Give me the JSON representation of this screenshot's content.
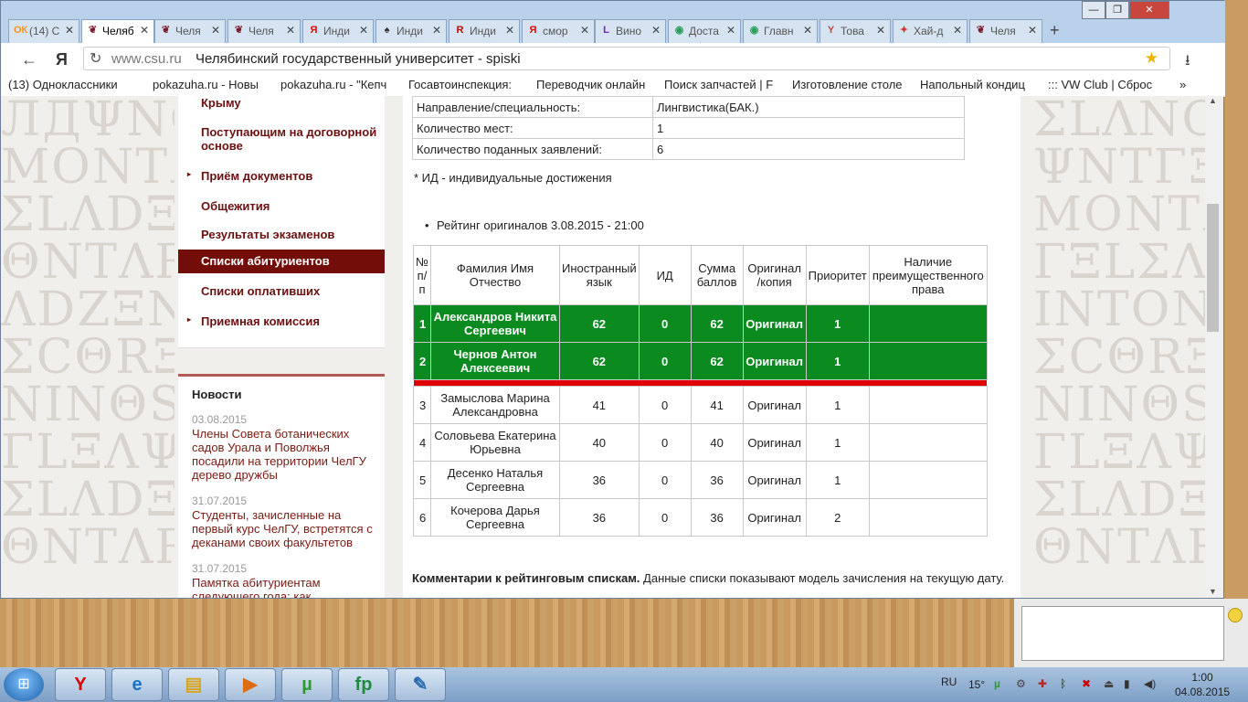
{
  "tabs": [
    {
      "label": "(14) C",
      "icon": "ok-icon",
      "active": false
    },
    {
      "label": "Челяб",
      "icon": "csu-icon",
      "active": true
    },
    {
      "label": "Челя",
      "icon": "csu-icon",
      "active": false
    },
    {
      "label": "Челя",
      "icon": "csu-icon",
      "active": false
    },
    {
      "label": "Инди",
      "icon": "yandex-icon",
      "active": false
    },
    {
      "label": "Инди",
      "icon": "spade-icon",
      "active": false
    },
    {
      "label": "Инди",
      "icon": "r-icon",
      "active": false
    },
    {
      "label": "смор",
      "icon": "yandex-icon",
      "active": false
    },
    {
      "label": "Вино",
      "icon": "l-icon",
      "active": false
    },
    {
      "label": "Доста",
      "icon": "globe-icon",
      "active": false
    },
    {
      "label": "Главн",
      "icon": "globe-icon",
      "active": false
    },
    {
      "label": "Това",
      "icon": "glass-icon",
      "active": false
    },
    {
      "label": "Хай-д",
      "icon": "star-icon",
      "active": false
    },
    {
      "label": "Челя",
      "icon": "csu-icon",
      "active": false
    }
  ],
  "window": {
    "minimize": "—",
    "maximize": "❐",
    "close": "✕"
  },
  "toolbar": {
    "back": "←",
    "brand": "Я",
    "reload": "↻",
    "url": "www.csu.ru",
    "title": "Челябинский государственный университет - spiski",
    "star": "★",
    "download": "⭳"
  },
  "bookmarks": [
    "(13) Одноклассники",
    "pokazuha.ru - Новы",
    "pokazuha.ru - \"Кепч",
    "Госавтоинспекция:",
    "Переводчик онлайн",
    "Поиск запчастей | F",
    "Изготовление столе",
    "Напольный кондиц",
    "::: VW Club | Сброс",
    "»"
  ],
  "sidebar": {
    "items": [
      {
        "label": "Крыму",
        "arrow": false
      },
      {
        "label": "Поступающим на договорной основе",
        "arrow": false
      },
      {
        "label": "Приём документов",
        "arrow": true
      },
      {
        "label": "Общежития",
        "arrow": false
      },
      {
        "label": "Результаты экзаменов",
        "arrow": false
      },
      {
        "label": "Списки абитуриентов",
        "arrow": false,
        "active": true
      },
      {
        "label": "Списки оплативших",
        "arrow": false
      },
      {
        "label": "Приемная комиссия",
        "arrow": true
      }
    ]
  },
  "news": {
    "title": "Новости",
    "items": [
      {
        "date": "03.08.2015",
        "text": "Члены Совета ботанических садов Урала и Поволжья посадили на территории ЧелГУ дерево дружбы"
      },
      {
        "date": "31.07.2015",
        "text": "Студенты, зачисленные на первый курс ЧелГУ, встретятся с деканами своих факультетов"
      },
      {
        "date": "31.07.2015",
        "text": "Памятка абитуриентам следующего года: как"
      }
    ]
  },
  "info": {
    "rows": [
      [
        "Направление/специальность:",
        "Лингвистика(БАК.)"
      ],
      [
        "Количество мест:",
        "1"
      ],
      [
        "Количество поданных заявлений:",
        "6"
      ]
    ],
    "note": "* ИД - индивидуальные достижения",
    "rating_title": "Рейтинг оригиналов 3.08.2015 - 21:00"
  },
  "ranking": {
    "headers": [
      "№ п/п",
      "Фамилия Имя Отчество",
      "Иностранный язык",
      "ИД",
      "Сумма баллов",
      "Оригинал /копия",
      "Приоритет",
      "Наличие преимущественного права"
    ],
    "rows": [
      {
        "n": "1",
        "name": "Александров Никита Сергеевич",
        "lang": "62",
        "id": "0",
        "sum": "62",
        "orig": "Оригинал",
        "prio": "1",
        "pref": "",
        "admitted": true
      },
      {
        "n": "2",
        "name": "Чернов Антон Алексеевич",
        "lang": "62",
        "id": "0",
        "sum": "62",
        "orig": "Оригинал",
        "prio": "1",
        "pref": "",
        "admitted": true
      },
      {
        "n": "3",
        "name": "Замыслова Марина Александровна",
        "lang": "41",
        "id": "0",
        "sum": "41",
        "orig": "Оригинал",
        "prio": "1",
        "pref": "",
        "admitted": false
      },
      {
        "n": "4",
        "name": "Соловьева Екатерина Юрьевна",
        "lang": "40",
        "id": "0",
        "sum": "40",
        "orig": "Оригинал",
        "prio": "1",
        "pref": "",
        "admitted": false
      },
      {
        "n": "5",
        "name": "Десенко Наталья Сергеевна",
        "lang": "36",
        "id": "0",
        "sum": "36",
        "orig": "Оригинал",
        "prio": "1",
        "pref": "",
        "admitted": false
      },
      {
        "n": "6",
        "name": "Кочерова Дарья Сергеевна",
        "lang": "36",
        "id": "0",
        "sum": "36",
        "orig": "Оригинал",
        "prio": "2",
        "pref": "",
        "admitted": false
      }
    ]
  },
  "comment": {
    "bold": "Комментарии к рейтинговым спискам.",
    "text": " Данные списки показывают модель зачисления на текущую дату."
  },
  "colors": {
    "accent": "#720d0a",
    "admitted": "#0a8a1f",
    "cutoff": "#e00000"
  },
  "taskbar": {
    "apps": [
      {
        "name": "yandex-browser-icon",
        "glyph": "Y",
        "color": "#e00000"
      },
      {
        "name": "ie-icon",
        "glyph": "e",
        "color": "#1a73c9"
      },
      {
        "name": "explorer-folder-icon",
        "glyph": "▤",
        "color": "#d9a520"
      },
      {
        "name": "media-player-icon",
        "glyph": "▶",
        "color": "#e06a10"
      },
      {
        "name": "utorrent-icon",
        "glyph": "µ",
        "color": "#2e9b2e"
      },
      {
        "name": "fastreport-icon",
        "glyph": "fp",
        "color": "#1f8a40"
      },
      {
        "name": "notepad-icon",
        "glyph": "✎",
        "color": "#2b6cb0"
      }
    ],
    "lang": "RU",
    "temp": "15°",
    "time": "1:00",
    "date": "04.08.2015"
  }
}
